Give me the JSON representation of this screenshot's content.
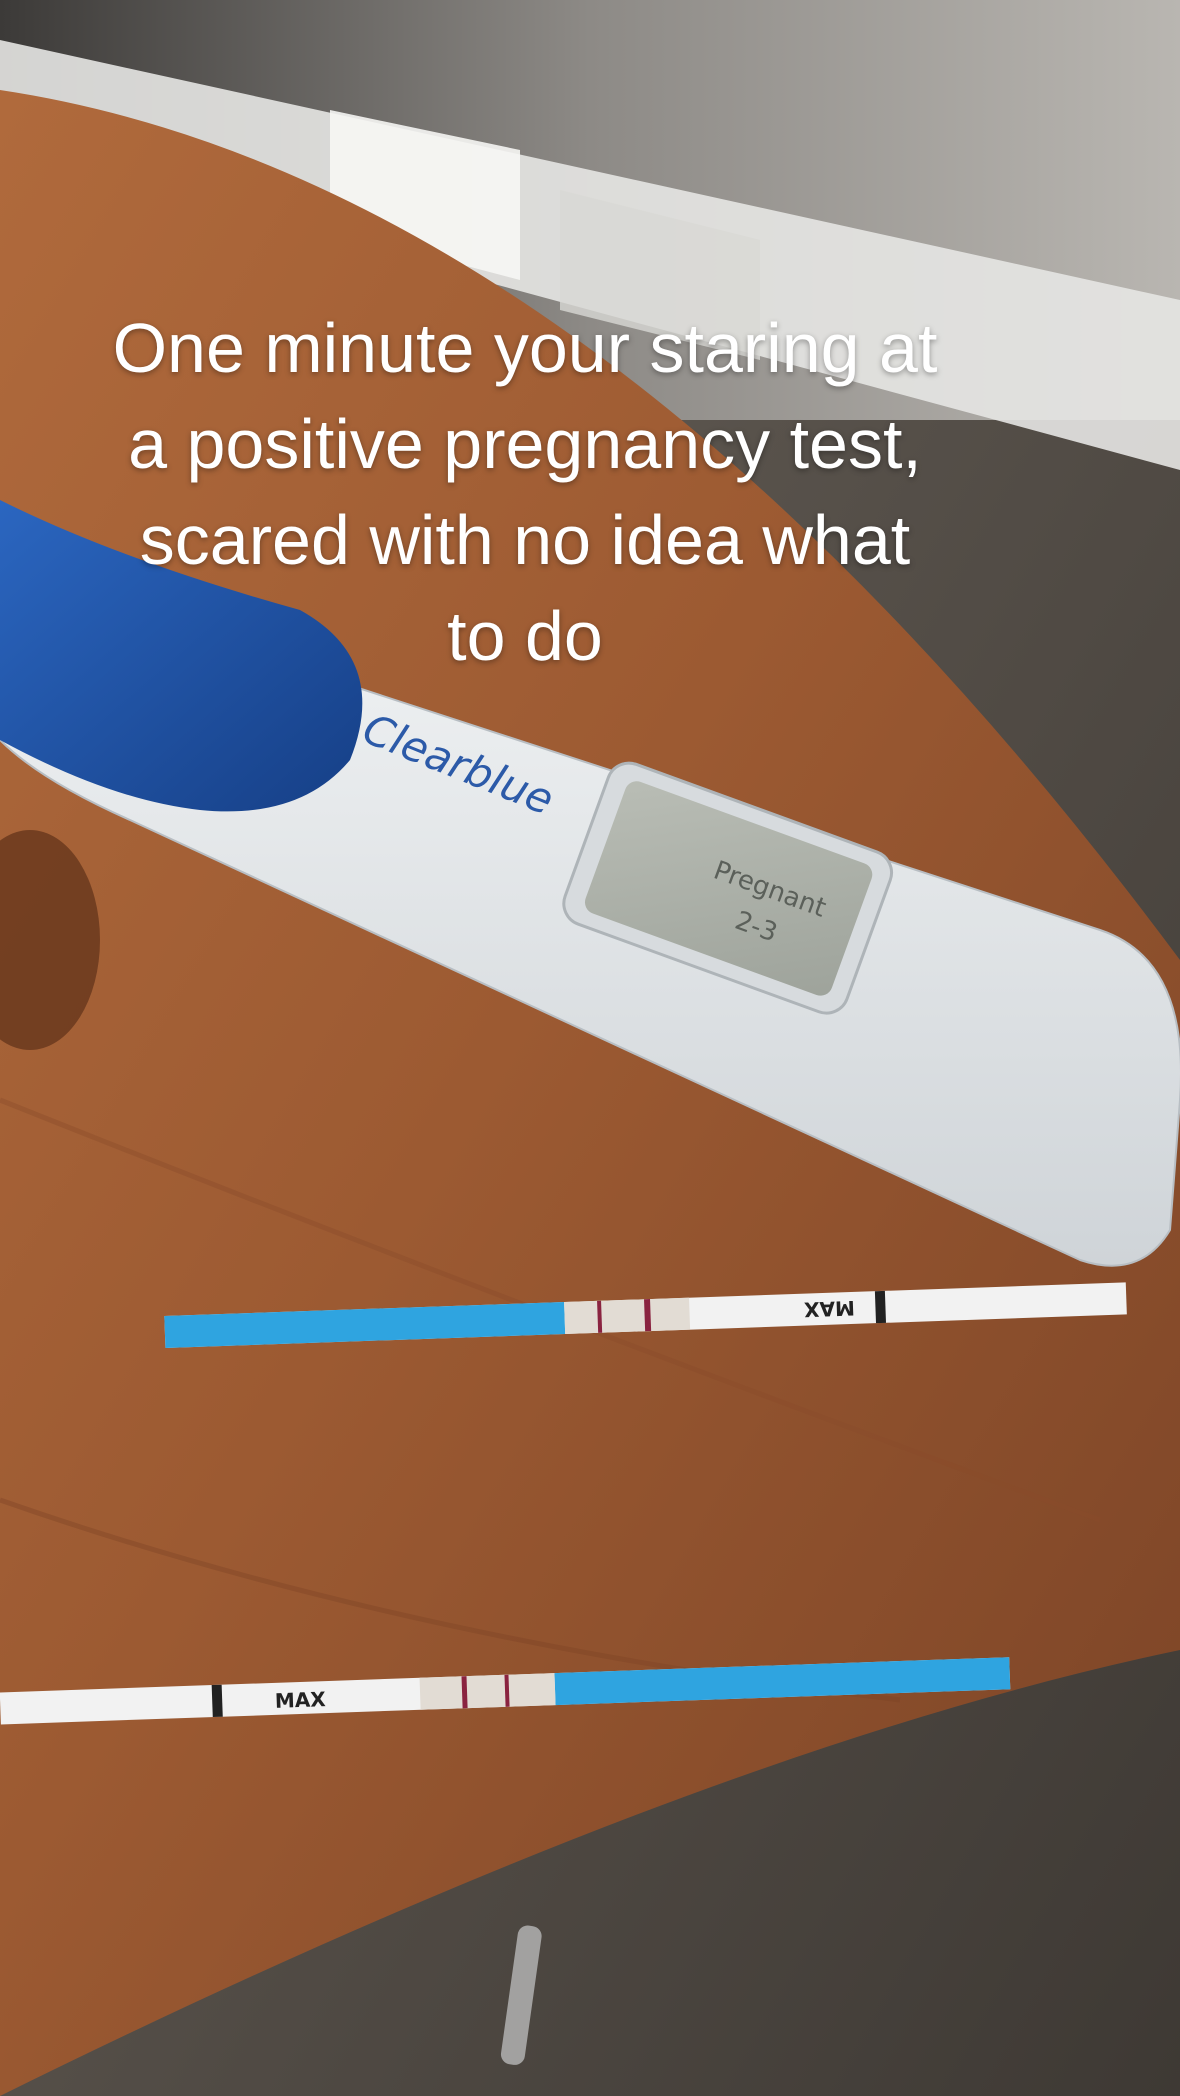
{
  "caption": {
    "lines": [
      "One minute your staring at",
      "a positive pregnancy test,",
      "scared with no idea what",
      "to do"
    ]
  },
  "digital_test": {
    "brand": "Clearblue",
    "display_line1": "Pregnant",
    "display_line2": "2-3",
    "body_color": "#e9ecee",
    "grip_color": "#1f56a8"
  },
  "strips": [
    {
      "label": "MAX",
      "dip_color": "#2fa4e0",
      "line_color": "#8a2340"
    },
    {
      "label": "MAX",
      "dip_color": "#2fa4e0",
      "line_color": "#8a2340"
    }
  ],
  "colors": {
    "table": "#9a5a34",
    "caption_text": "#ffffff"
  }
}
